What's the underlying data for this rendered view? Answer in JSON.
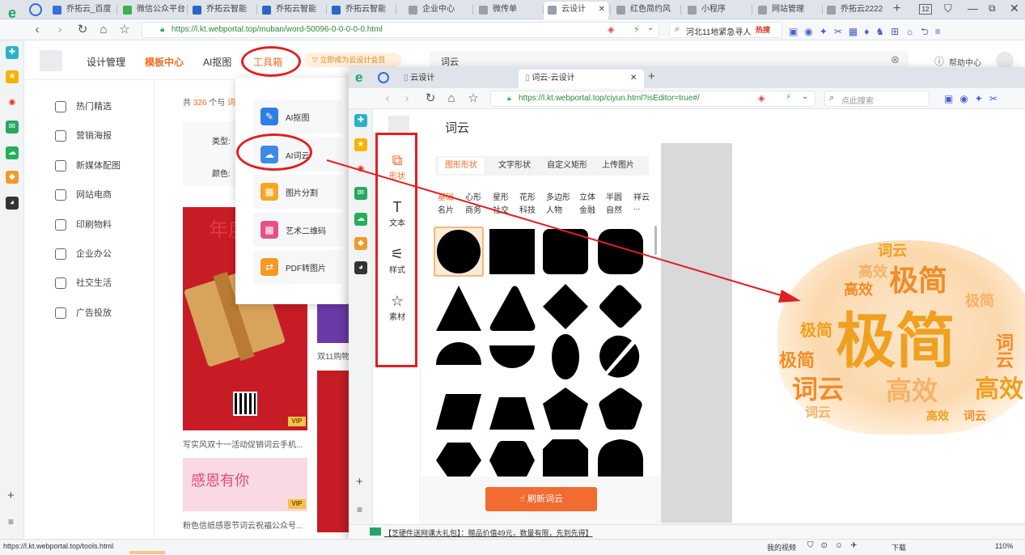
{
  "browser": {
    "tabs": [
      {
        "label": "乔拓云_百度",
        "color": "#3b6fd8"
      },
      {
        "label": "微信公众平台",
        "color": "#3bb14a"
      },
      {
        "label": "乔拓云智能",
        "color": "#2a66c8"
      },
      {
        "label": "乔拓云智能",
        "color": "#2a66c8"
      },
      {
        "label": "乔拓云智能",
        "color": "#2a66c8"
      },
      {
        "label": "企业中心",
        "color": "#9aa0a8"
      },
      {
        "label": "微传单",
        "color": "#9aa0a8"
      },
      {
        "label": "云设计",
        "color": "#9aa0a8",
        "active": true
      },
      {
        "label": "红色简约风",
        "color": "#9aa0a8"
      },
      {
        "label": "小程序",
        "color": "#9aa0a8"
      },
      {
        "label": "网站管理",
        "color": "#9aa0a8"
      },
      {
        "label": "乔拓云2222",
        "color": "#9aa0a8"
      }
    ],
    "tab_count": "12",
    "url": "https://l.kt.webportal.top/muban/word-50096-0-0-0-0-0.html",
    "search_text": "河北11地紧急寻人",
    "hot_label": "热搜",
    "status_url": "https://l.kt.webportal.top/tools.html",
    "status_items": [
      "我的视频",
      "下载",
      "110%"
    ]
  },
  "site": {
    "nav": [
      "设计管理",
      "模板中心",
      "AI抠图",
      "工具箱"
    ],
    "member_btn": "立即成为云设计会员",
    "search_value": "词云",
    "help": "帮助中心",
    "result_prefix": "共",
    "result_count": "326",
    "result_suffix": "个与",
    "result_kw": "词",
    "filter_type": "类型:",
    "filter_color": "颜色:",
    "left_menu": [
      "热门精选",
      "营销海报",
      "新媒体配图",
      "网站电商",
      "印刷物料",
      "企业办公",
      "社交生活",
      "广告投放"
    ],
    "cards": [
      {
        "caption": "写实风双十一活动促销词云手机...",
        "badge": "VIP"
      },
      {
        "caption": "粉色信纸感恩节词云祝福公众号...",
        "badge": "VIP",
        "title": "感恩有你"
      },
      {
        "caption": "双11购物"
      }
    ]
  },
  "dropdown": [
    {
      "label": "AI抠图",
      "color": "#2f7ee6"
    },
    {
      "label": "AI词云",
      "color": "#3f8ae8"
    },
    {
      "label": "图片分割",
      "color": "#f5a623"
    },
    {
      "label": "艺术二维码",
      "color": "#e8508a"
    },
    {
      "label": "PDF转图片",
      "color": "#f59a23"
    }
  ],
  "editor": {
    "tabs": [
      "云设计",
      "词云-云设计"
    ],
    "url": "https://l.kt.webportal.top/ciyun.html?isEditor=true#/",
    "search_placeholder": "点此搜索",
    "title": "词云",
    "tools": [
      "形状",
      "文本",
      "样式",
      "素材"
    ],
    "shape_tabs": [
      "图形形状",
      "文字形状",
      "自定义矩形",
      "上传图片"
    ],
    "categories_row1": [
      "基础",
      "心形",
      "星形",
      "花形",
      "多边形",
      "立体",
      "半圆",
      "祥云"
    ],
    "categories_row2": [
      "名片",
      "商务",
      "社交",
      "科技",
      "人物",
      "金融",
      "自然",
      "..."
    ],
    "refresh_btn": "刷新词云",
    "bottom_ad": "【芝硬件送网课大礼包】：赠品价值49元，数量有限，先到先得】",
    "wordcloud": [
      {
        "text": "极简",
        "size": 74,
        "color": "#f0a020"
      },
      {
        "text": "词云",
        "size": 32,
        "color": "#f28c28"
      },
      {
        "text": "高效",
        "size": 32,
        "color": "#f7b267"
      },
      {
        "text": "极简",
        "size": 36,
        "color": "#f28c28"
      }
    ]
  }
}
